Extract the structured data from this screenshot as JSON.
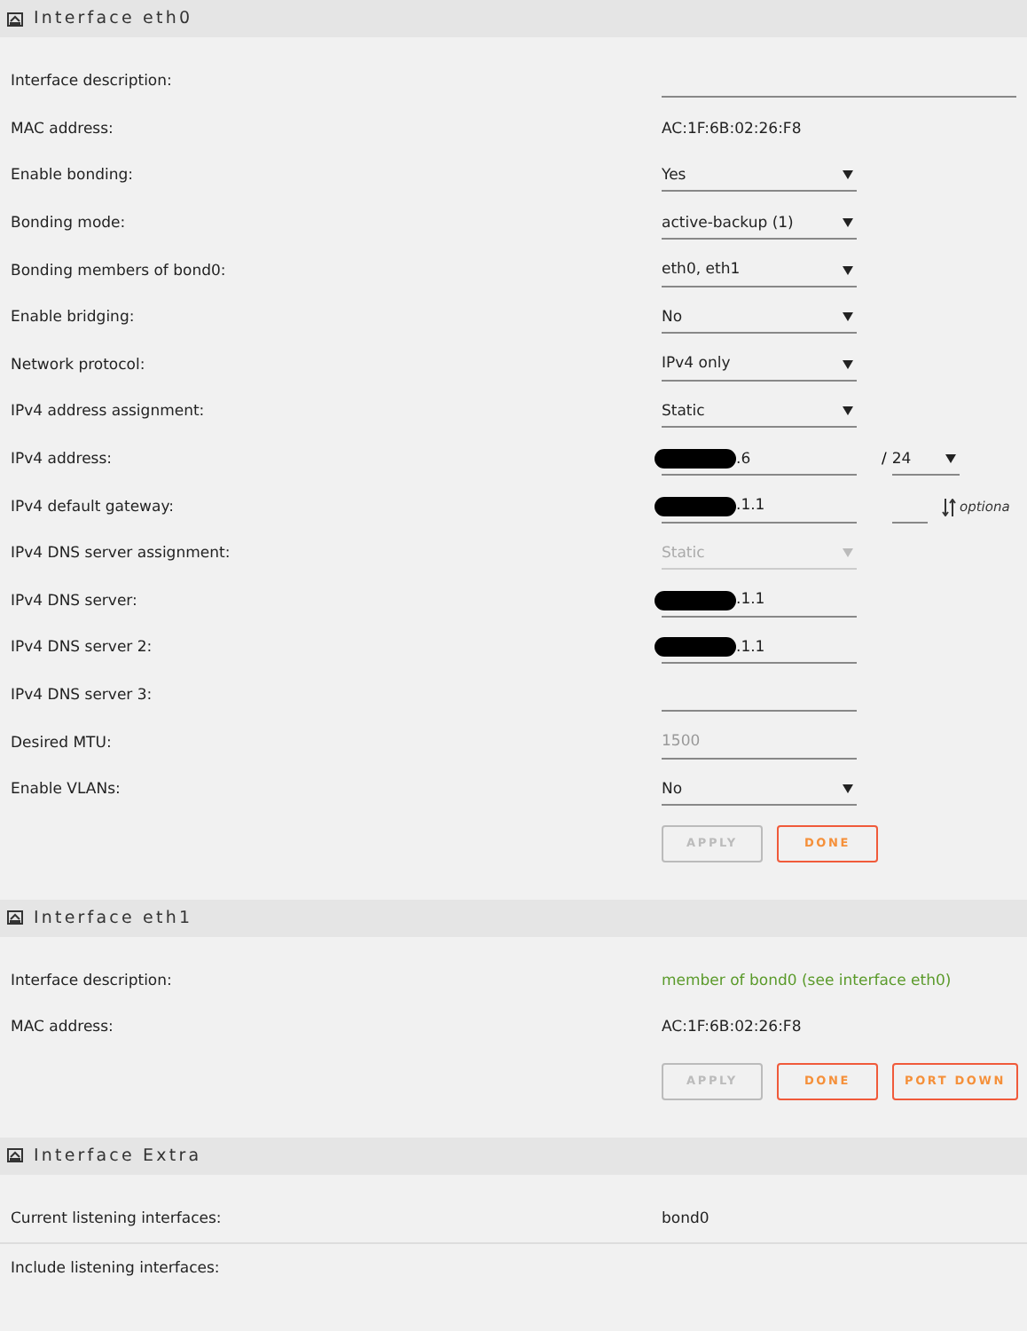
{
  "sections": [
    {
      "title": "Interface eth0",
      "rows": [
        {
          "label": "Interface description:",
          "kind": "field",
          "wide": true
        },
        {
          "label": "MAC address:",
          "kind": "static",
          "value": "AC:1F:6B:02:26:F8"
        },
        {
          "label": "Enable bonding:",
          "kind": "select",
          "value": "Yes",
          "disabled": false
        },
        {
          "label": "Bonding mode:",
          "kind": "select",
          "value": "active-backup (1)",
          "disabled": false
        },
        {
          "label": "Bonding members of bond0:",
          "kind": "select",
          "value": "eth0, eth1",
          "disabled": false
        },
        {
          "label": "Enable bridging:",
          "kind": "select",
          "value": "No",
          "disabled": false
        },
        {
          "label": "Network protocol:",
          "kind": "select",
          "value": "IPv4 only",
          "disabled": false
        },
        {
          "label": "IPv4 address assignment:",
          "kind": "select",
          "value": "Static",
          "disabled": false
        },
        {
          "label": "IPv4 address:",
          "kind": "field",
          "value": ".6",
          "redacted": true,
          "prefix": {
            "separator": "/",
            "value": "24"
          }
        },
        {
          "label": "IPv4 default gateway:",
          "kind": "field",
          "value": ".1.1",
          "redacted": true,
          "metric": {
            "hint": "optiona"
          }
        },
        {
          "label": "IPv4 DNS server assignment:",
          "kind": "select",
          "value": "Static",
          "disabled": true
        },
        {
          "label": "IPv4 DNS server:",
          "kind": "field",
          "value": ".1.1",
          "redacted": true
        },
        {
          "label": "IPv4 DNS server 2:",
          "kind": "field",
          "value": ".1.1",
          "redacted": true
        },
        {
          "label": "IPv4 DNS server 3:",
          "kind": "field"
        },
        {
          "label": "Desired MTU:",
          "kind": "field",
          "placeholder": "1500"
        },
        {
          "label": "Enable VLANs:",
          "kind": "select",
          "value": "No",
          "disabled": false
        }
      ],
      "buttons": [
        {
          "label": "APPLY",
          "disabled": true
        },
        {
          "label": "DONE",
          "disabled": false
        }
      ]
    },
    {
      "title": "Interface eth1",
      "rows": [
        {
          "label": "Interface description:",
          "kind": "note",
          "value": "member of bond0 (see interface eth0)"
        },
        {
          "label": "MAC address:",
          "kind": "static",
          "value": "AC:1F:6B:02:26:F8"
        }
      ],
      "buttons": [
        {
          "label": "APPLY",
          "disabled": true
        },
        {
          "label": "DONE",
          "disabled": false
        },
        {
          "label": "PORT DOWN",
          "disabled": false
        }
      ]
    },
    {
      "title": "Interface Extra",
      "rows": [
        {
          "label": "Current listening interfaces:",
          "kind": "static",
          "value": "bond0"
        },
        {
          "label": "Include listening interfaces:",
          "kind": "empty"
        }
      ]
    }
  ]
}
